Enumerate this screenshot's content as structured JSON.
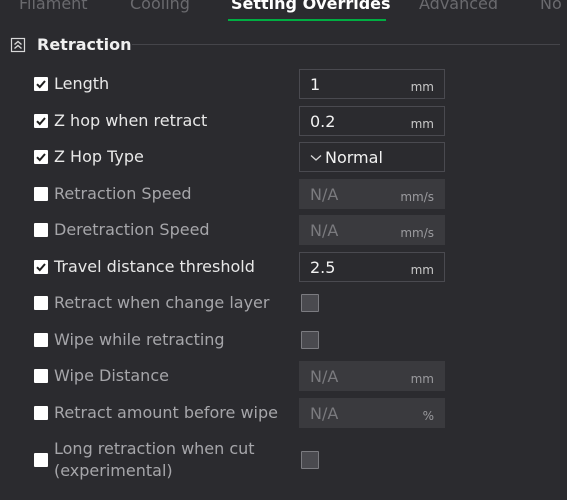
{
  "tabs": [
    "Filament",
    "Cooling",
    "Setting Overrides",
    "Advanced",
    "No"
  ],
  "active_tab": "Setting Overrides",
  "accent_color": "#00ae42",
  "section": {
    "title": "Retraction",
    "icon": "collapse-icon"
  },
  "rows": [
    {
      "label": "Length",
      "checked": true,
      "control": "field",
      "value": "1",
      "unit": "mm",
      "disabled": false
    },
    {
      "label": "Z hop when retract",
      "checked": true,
      "control": "field",
      "value": "0.2",
      "unit": "mm",
      "disabled": false
    },
    {
      "label": "Z Hop Type",
      "checked": true,
      "control": "select",
      "value": "Normal"
    },
    {
      "label": "Retraction Speed",
      "checked": false,
      "control": "field",
      "value": "N/A",
      "unit": "mm/s",
      "disabled": true
    },
    {
      "label": "Deretraction Speed",
      "checked": false,
      "control": "field",
      "value": "N/A",
      "unit": "mm/s",
      "disabled": true
    },
    {
      "label": "Travel distance threshold",
      "checked": true,
      "control": "field",
      "value": "2.5",
      "unit": "mm",
      "disabled": false
    },
    {
      "label": "Retract when change layer",
      "checked": false,
      "control": "checkbox"
    },
    {
      "label": "Wipe while retracting",
      "checked": false,
      "control": "checkbox"
    },
    {
      "label": "Wipe Distance",
      "checked": false,
      "control": "field",
      "value": "N/A",
      "unit": "mm",
      "disabled": true
    },
    {
      "label": "Retract amount before wipe",
      "checked": false,
      "control": "field",
      "value": "N/A",
      "unit": "%",
      "disabled": true
    },
    {
      "label": "Long retraction when cut",
      "label2": "(experimental)",
      "checked": false,
      "control": "checkbox"
    }
  ]
}
